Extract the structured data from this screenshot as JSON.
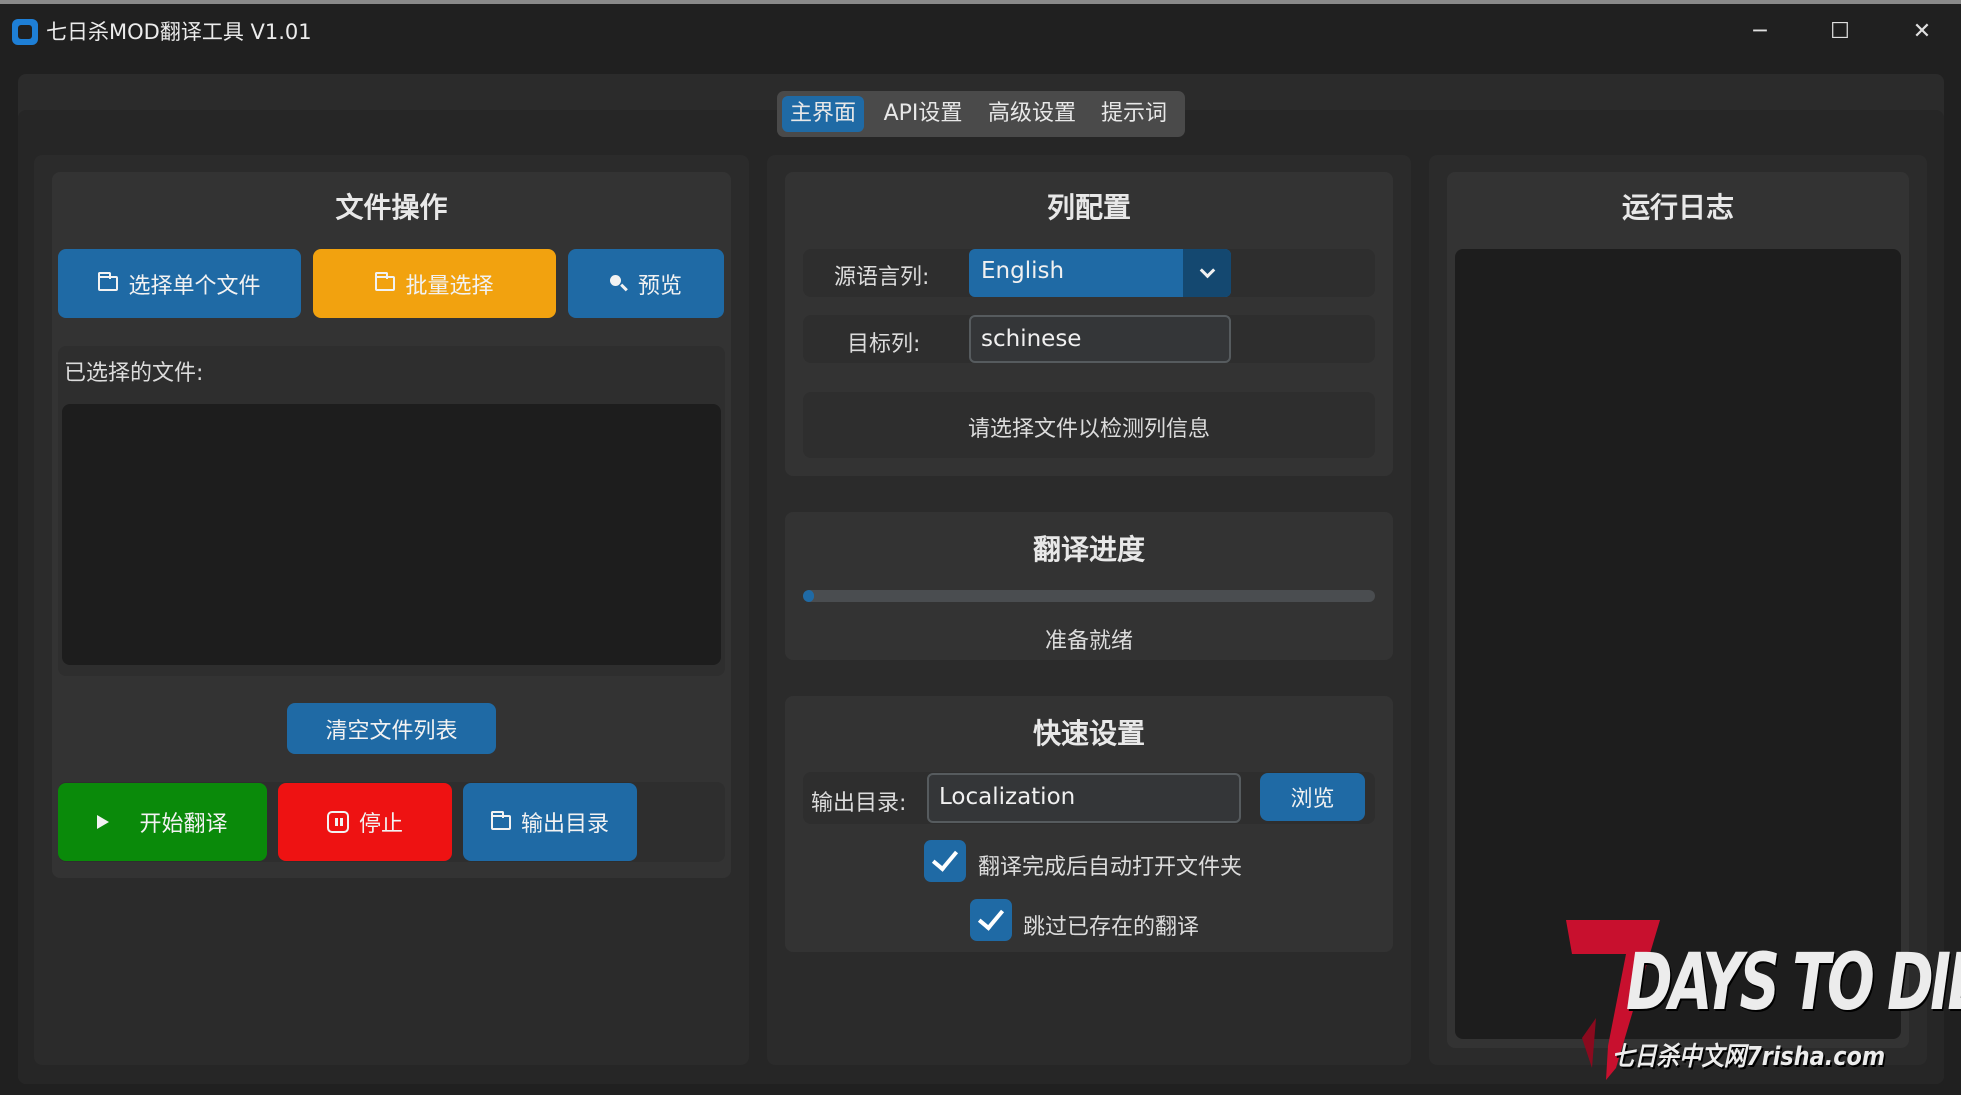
{
  "window": {
    "title": "七日杀MOD翻译工具 V1.01",
    "minimize_glyph": "─",
    "maximize_glyph": "☐",
    "close_glyph": "✕"
  },
  "tabs": [
    {
      "label": "主界面",
      "active": true
    },
    {
      "label": "API设置",
      "active": false
    },
    {
      "label": "高级设置",
      "active": false
    },
    {
      "label": "提示词",
      "active": false
    }
  ],
  "file_ops": {
    "title": "文件操作",
    "select_single": "选择单个文件",
    "batch_select": "批量选择",
    "preview": "预览",
    "selected_label": "已选择的文件:",
    "clear_list": "清空文件列表",
    "start": "开始翻译",
    "stop": "停止",
    "output_dir": "输出目录"
  },
  "column_config": {
    "title": "列配置",
    "source_label": "源语言列:",
    "source_value": "English",
    "target_label": "目标列:",
    "target_value": "schinese",
    "info": "请选择文件以检测列信息"
  },
  "progress": {
    "title": "翻译进度",
    "value": 0.02,
    "status": "准备就绪"
  },
  "quick_settings": {
    "title": "快速设置",
    "output_label": "输出目录:",
    "output_value": "Localization",
    "browse": "浏览",
    "auto_open": "翻译完成后自动打开文件夹",
    "auto_open_checked": true,
    "skip_existing": "跳过已存在的翻译",
    "skip_existing_checked": true
  },
  "log": {
    "title": "运行日志"
  },
  "logo": {
    "days": "DAYS TO DIE",
    "sub": "七日杀中文网7risha.com"
  },
  "colors": {
    "accent": "#1f6aa5",
    "orange": "#f2a20f",
    "green": "#0a8a0a",
    "red": "#ee1212",
    "logo_red": "#c8102e"
  }
}
